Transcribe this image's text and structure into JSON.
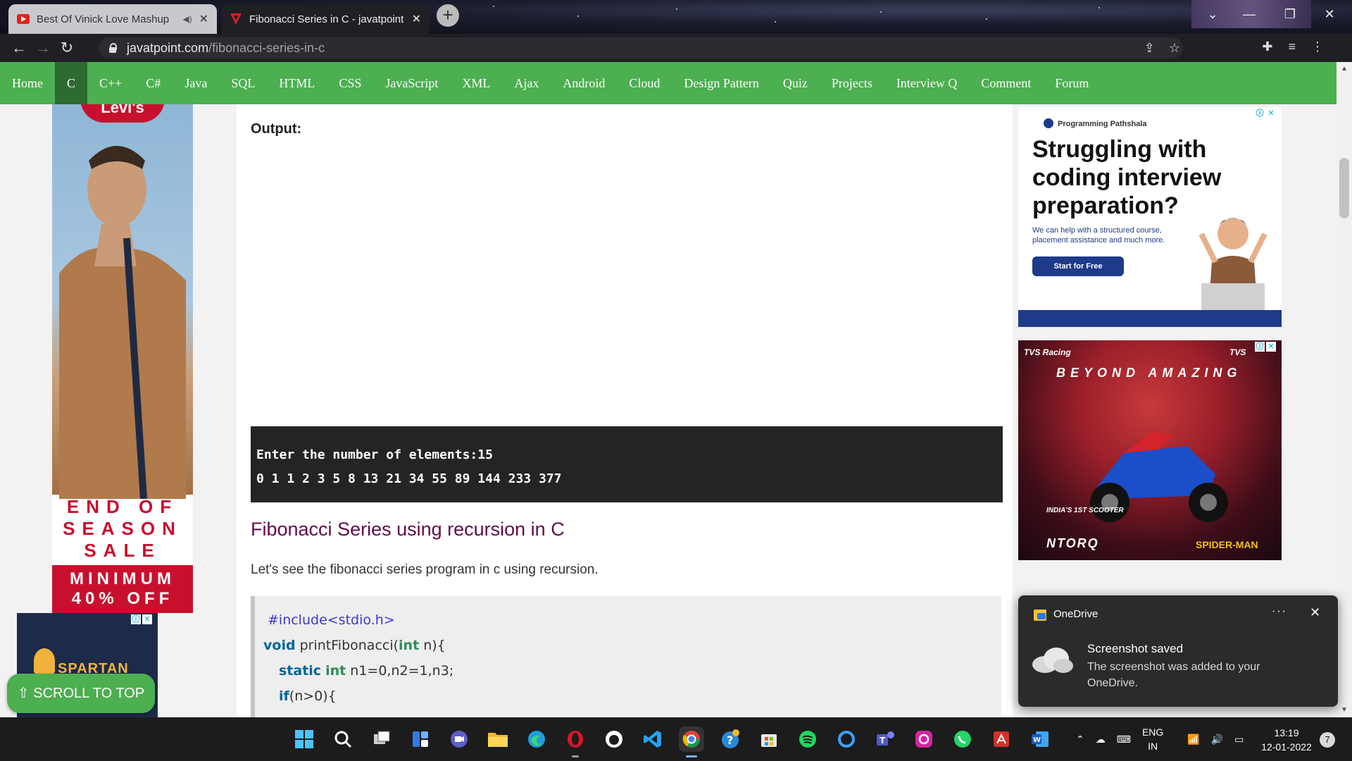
{
  "browser": {
    "tabs": [
      {
        "title": "Best Of Vinick Love Mashup",
        "favicon": "youtube-icon",
        "audio": true
      },
      {
        "title": "Fibonacci Series in C - javatpoint",
        "favicon": "javatpoint-icon",
        "active": true
      }
    ],
    "url": {
      "host": "javatpoint.com",
      "path": "/fibonacci-series-in-c"
    },
    "new_tab_label": "+"
  },
  "site_nav": [
    "Home",
    "C",
    "C++",
    "C#",
    "Java",
    "SQL",
    "HTML",
    "CSS",
    "JavaScript",
    "XML",
    "Ajax",
    "Android",
    "Cloud",
    "Design Pattern",
    "Quiz",
    "Projects",
    "Interview Q",
    "Comment",
    "Forum"
  ],
  "site_nav_active": "C",
  "main": {
    "output_label": "Output:",
    "console_lines": [
      "Enter the number of elements:15",
      "0 1 1 2 3 5 8 13 21 34 55 89 144 233 377"
    ],
    "section_title": "Fibonacci Series using recursion in C",
    "section_desc": "Let's see the fibonacci series program in c using recursion.",
    "code": {
      "line1": "#include<stdio.h>",
      "line2_kw": "void",
      "line2_rest": " printFibonacci(",
      "line2_ty": "int",
      "line2_end": " n){",
      "line3_kw": "static",
      "line3_ty": "int",
      "line3_rest": " n1=0,n2=1,n3;",
      "line4_kw": "if",
      "line4_rest": "(n>0){"
    }
  },
  "left_ad": {
    "brand": "Levi's",
    "line1": "END OF",
    "line2": "SEASON",
    "line3": "SALE",
    "min1": "MINIMUM",
    "min2": "40% OFF"
  },
  "spartan_ad": {
    "text": "SPARTAN"
  },
  "scroll_top": "⇧ SCROLL TO TOP",
  "right_ad_1": {
    "brand": "Programming Pathshala",
    "headline": "Struggling with coding interview preparation?",
    "sub": "We can help with a structured course, placement assistance and much more.",
    "cta": "Start for Free"
  },
  "right_ad_2": {
    "brand_left": "TVS Racing",
    "brand_right": "TVS",
    "tagline": "BEYOND AMAZING",
    "footnote": "INDIA'S 1ST SCOOTER",
    "product": "NTORQ",
    "partner": "SPIDER-MAN"
  },
  "toast": {
    "app": "OneDrive",
    "title": "Screenshot saved",
    "body": "The screenshot was added to your OneDrive.",
    "more": "···",
    "close": "✕"
  },
  "taskbar": {
    "lang_top": "ENG",
    "lang_bottom": "IN",
    "time": "13:19",
    "date": "12-01-2022",
    "notifications": "7"
  },
  "colors": {
    "site_green": "#4caf50",
    "site_green_active": "#2e6b31",
    "heading": "#610b4b"
  }
}
